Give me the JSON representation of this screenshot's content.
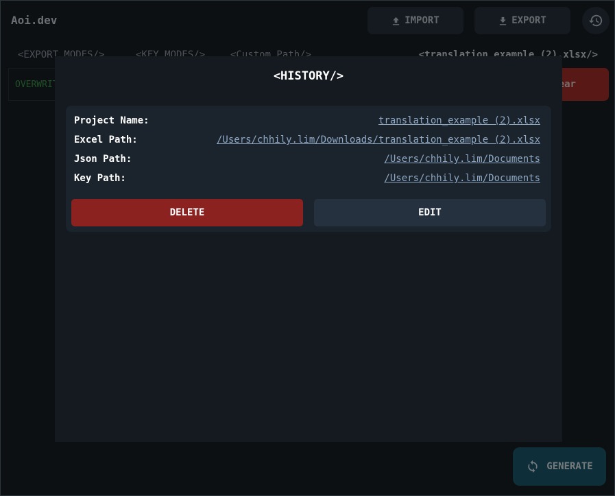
{
  "app": {
    "title": "Aoi.dev"
  },
  "toolbar": {
    "import_label": "IMPORT",
    "export_label": "EXPORT",
    "history_icon": "history-icon"
  },
  "tabs": [
    {
      "label": "<EXPORT MODES/>"
    },
    {
      "label": "<KEY MODES/>"
    },
    {
      "label": "<Custom Path/>"
    }
  ],
  "current_file": "<translation_example (2).xlsx/>",
  "mode": {
    "value": "OVERWRITE"
  },
  "clear_button": {
    "label": "Clear"
  },
  "generate_button": {
    "label": "GENERATE"
  },
  "modal": {
    "title": "<HISTORY/>",
    "entry": {
      "rows": [
        {
          "label": "Project Name:",
          "value": "translation_example (2).xlsx"
        },
        {
          "label": "Excel Path:",
          "value": "/Users/chhily.lim/Downloads/translation_example (2).xlsx"
        },
        {
          "label": "Json Path:",
          "value": "/Users/chhily.lim/Documents"
        },
        {
          "label": "Key Path:",
          "value": "/Users/chhily.lim/Documents"
        }
      ],
      "delete_label": "DELETE",
      "edit_label": "EDIT"
    }
  },
  "colors": {
    "danger": "#8b2220",
    "accent": "#1c5f73",
    "link": "#8fa8c4",
    "success": "#3fa34d"
  }
}
